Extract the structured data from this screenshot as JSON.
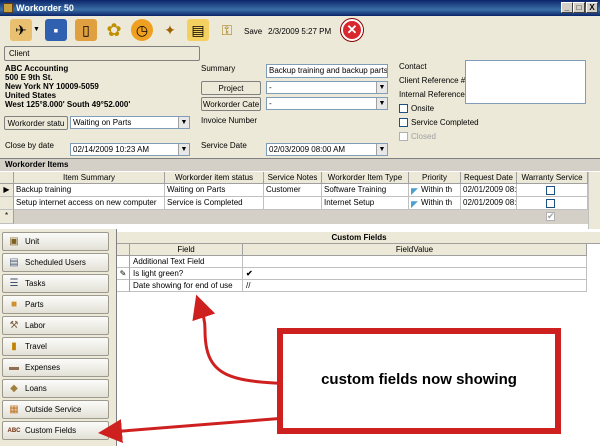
{
  "window": {
    "title": "Workorder 50",
    "minimize": "_",
    "maximize": "□",
    "close": "X"
  },
  "toolbar": {
    "save_label": "Save",
    "datetime": "2/3/2009 5:27 PM",
    "close_glyph": "✕"
  },
  "client": {
    "button_label": "Client",
    "address": [
      "ABC Accounting",
      "500 E 9th St.",
      "New York NY 10009-5059",
      "United States",
      "West 125°8.000' South 49°52.000'"
    ]
  },
  "form": {
    "summary_label": "Summary",
    "summary_value": "Backup training and backup parts",
    "project_label": "Project",
    "project_value": "-",
    "category_label": "Workorder Cate",
    "category_value": "-",
    "invoice_label": "Invoice Number",
    "status_button": "Workorder statu",
    "status_value": "Waiting on Parts",
    "close_by_label": "Close by date",
    "close_by_value": "02/14/2009 10:23 AM",
    "service_date_label": "Service Date",
    "service_date_value": "02/03/2009 08:00 AM",
    "contact_label": "Contact",
    "client_ref_label": "Client Reference #",
    "internal_ref_label": "Internal Reference",
    "onsite_label": "Onsite",
    "service_completed_label": "Service Completed",
    "closed_label": "Closed"
  },
  "items": {
    "section_title": "Workorder Items",
    "columns": [
      "Item Summary",
      "Workorder item status",
      "Service Notes",
      "Workorder Item Type",
      "Priority",
      "Request Date",
      "Warranty Service"
    ],
    "rows": [
      {
        "marker": "▶",
        "summary": "Backup training",
        "status": "Waiting on Parts",
        "notes": "Customer",
        "type": "Software Training",
        "priority": "Within th",
        "date": "02/01/2009 08:"
      },
      {
        "marker": "",
        "summary": "Setup internet access on new computer",
        "status": "Service is Completed",
        "notes": "",
        "type": "Internet Setup",
        "priority": "Within th",
        "date": "02/01/2009 08:"
      }
    ],
    "new_row_marker": "*"
  },
  "nav": [
    {
      "label": "Unit",
      "icon": "unit-icon",
      "glyph": "▣"
    },
    {
      "label": "Scheduled Users",
      "icon": "scheduled-users-icon",
      "glyph": "▤"
    },
    {
      "label": "Tasks",
      "icon": "tasks-icon",
      "glyph": "☰"
    },
    {
      "label": "Parts",
      "icon": "parts-icon",
      "glyph": "■"
    },
    {
      "label": "Labor",
      "icon": "labor-icon",
      "glyph": "⚒"
    },
    {
      "label": "Travel",
      "icon": "travel-icon",
      "glyph": "▮"
    },
    {
      "label": "Expenses",
      "icon": "expenses-icon",
      "glyph": "▬"
    },
    {
      "label": "Loans",
      "icon": "loans-icon",
      "glyph": "◆"
    },
    {
      "label": "Outside Service",
      "icon": "outside-service-icon",
      "glyph": "▦"
    },
    {
      "label": "Custom Fields",
      "icon": "custom-fields-icon",
      "glyph": "ABC"
    }
  ],
  "custom_fields": {
    "title": "Custom Fields",
    "col_field": "Field",
    "col_value": "FieldValue",
    "rows": [
      {
        "field": "Additional Text Field",
        "value": ""
      },
      {
        "field": "Is light green?",
        "value": "✔"
      },
      {
        "field": "Date showing for end of use",
        "value": "//"
      }
    ],
    "editing_marker": "✎"
  },
  "callout": {
    "text": "custom fields now showing"
  },
  "colors": {
    "titlebar": "#0a246a",
    "callout_border": "#cf2020",
    "face": "#ece9d8"
  }
}
